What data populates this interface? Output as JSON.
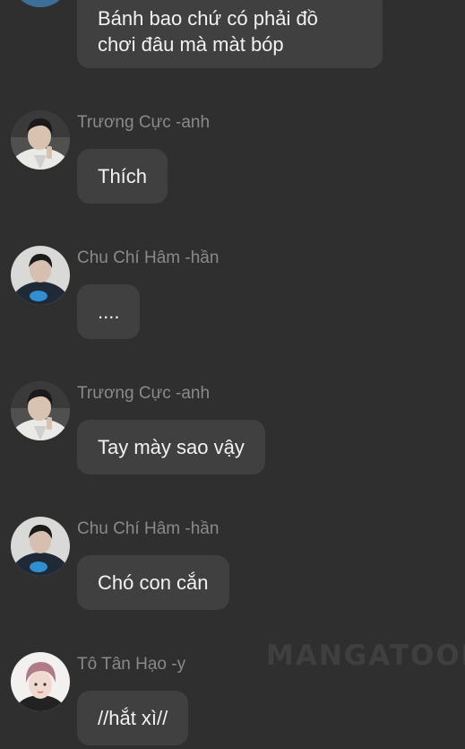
{
  "colors": {
    "background": "#2f2f2f",
    "bubble": "#404040",
    "bubble_text": "#f2f2f2",
    "sender_text": "#8a8a8a"
  },
  "messages": [
    {
      "sender": "",
      "avatar": "avatar-partial",
      "text": "Bánh bao chứ có phải đồ\nchơi đâu mà màt bóp"
    },
    {
      "sender": "Trương Cực -anh",
      "avatar": "avatar-white-shirt",
      "text": "Thích"
    },
    {
      "sender": "Chu Chí Hâm -hần",
      "avatar": "avatar-dark-shirt",
      "text": "...."
    },
    {
      "sender": "Trương Cực -anh",
      "avatar": "avatar-white-shirt",
      "text": "Tay mày sao vậy"
    },
    {
      "sender": "Chu Chí Hâm -hần",
      "avatar": "avatar-dark-shirt",
      "text": "Chó con cắn"
    },
    {
      "sender": "Tô Tân Hạo -y",
      "avatar": "avatar-pink-hair",
      "text": "//hắt xì//"
    }
  ],
  "watermark": "MANGATOON"
}
